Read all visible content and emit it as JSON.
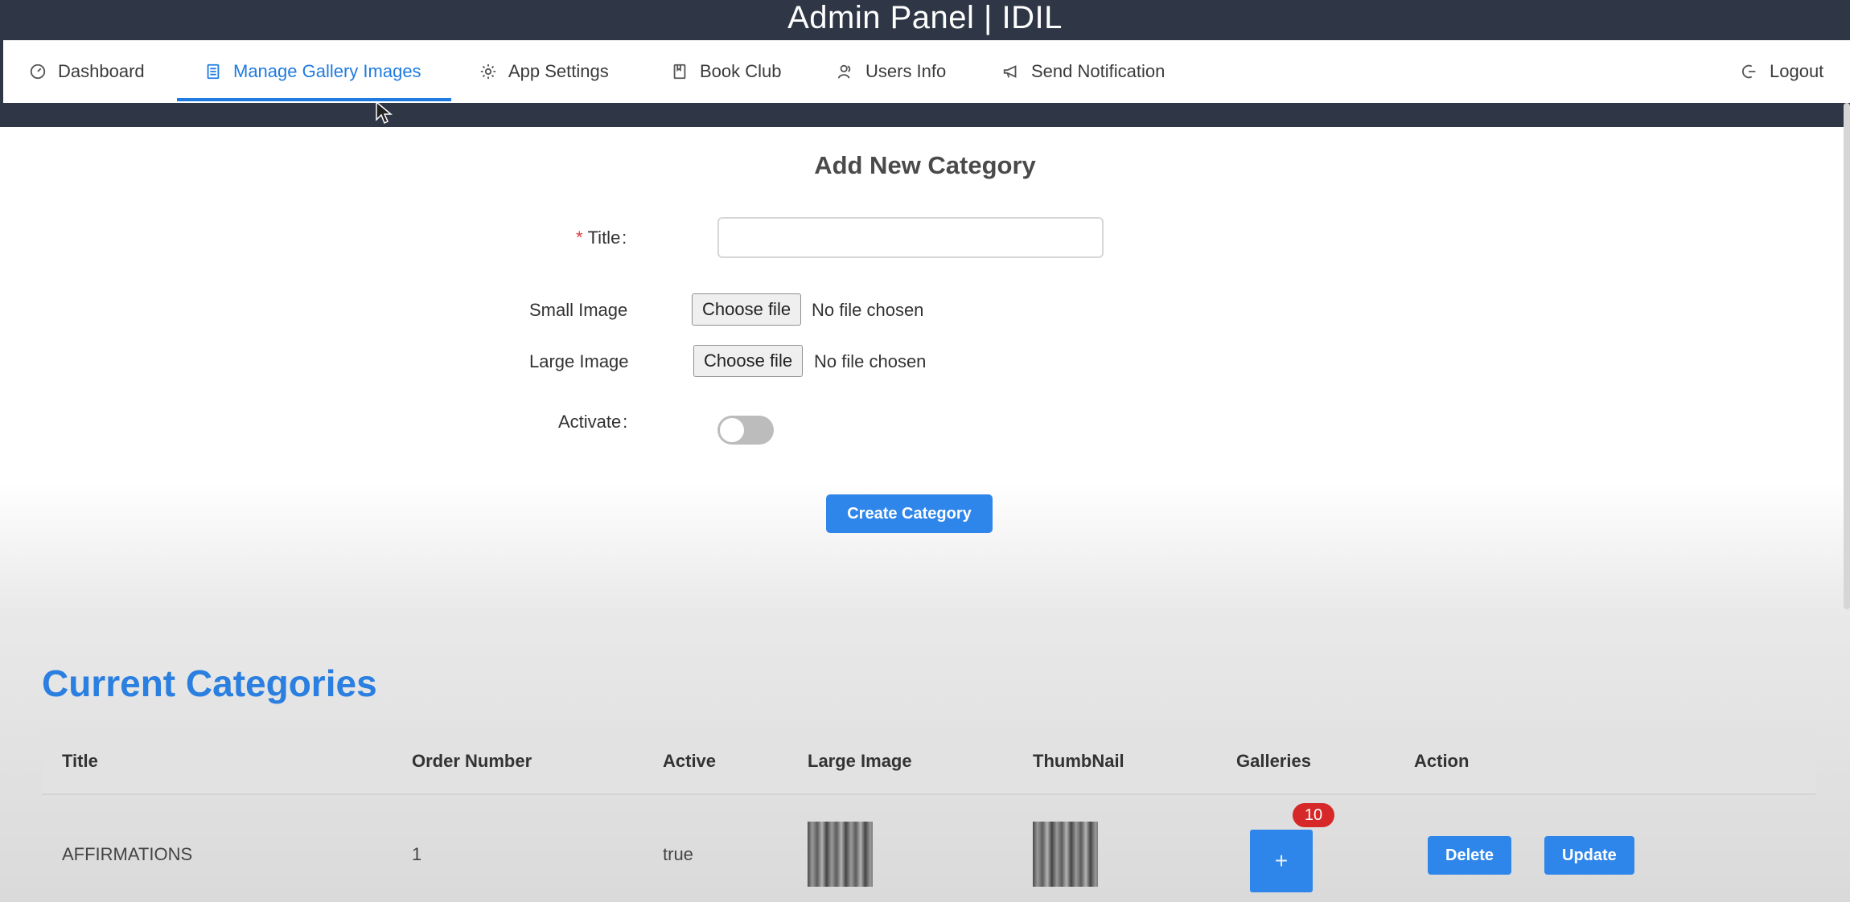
{
  "header": {
    "title": "Admin Panel | IDIL"
  },
  "nav": {
    "items": [
      {
        "label": "Dashboard",
        "icon": "dashboard-icon"
      },
      {
        "label": "Manage Gallery Images",
        "icon": "gallery-icon",
        "active": true
      },
      {
        "label": "App Settings",
        "icon": "gear-icon"
      },
      {
        "label": "Book Club",
        "icon": "book-icon"
      },
      {
        "label": "Users Info",
        "icon": "users-icon"
      },
      {
        "label": "Send Notification",
        "icon": "megaphone-icon"
      }
    ],
    "logout": {
      "label": "Logout",
      "icon": "logout-icon"
    }
  },
  "form": {
    "heading": "Add New Category",
    "title_label": "Title",
    "title_required_mark": "*",
    "title_value": "",
    "small_image_label": "Small Image",
    "large_image_label": "Large Image",
    "choose_file_label": "Choose file",
    "no_file_text": "No file chosen",
    "activate_label": "Activate",
    "activate_on": false,
    "submit_label": "Create Category"
  },
  "categories": {
    "heading": "Current Categories",
    "columns": [
      "Title",
      "Order Number",
      "Active",
      "Large Image",
      "ThumbNail",
      "Galleries",
      "Action"
    ],
    "rows": [
      {
        "title": "AFFIRMATIONS",
        "order_number": "1",
        "active": "true",
        "galleries_count": "10",
        "galleries_button": "+",
        "delete_label": "Delete",
        "update_label": "Update"
      }
    ]
  },
  "colors": {
    "topbar": "#2f3746",
    "accent": "#1f7be0",
    "button": "#2f86ea",
    "badge": "#d62828"
  }
}
